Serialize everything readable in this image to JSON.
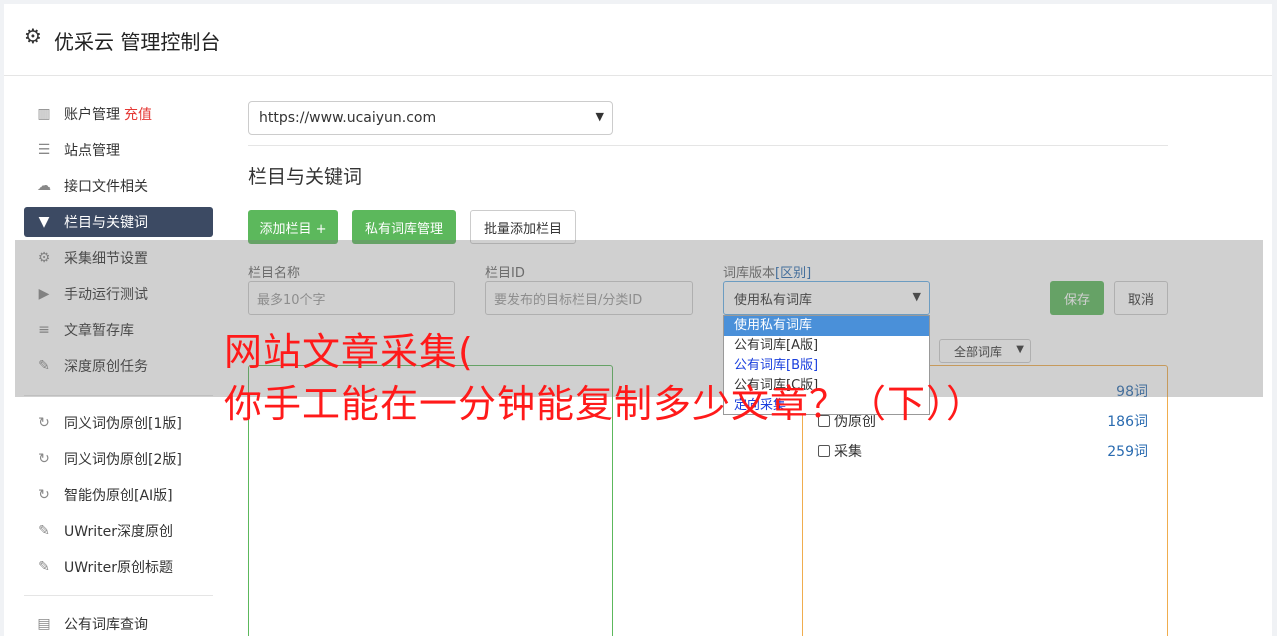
{
  "header": {
    "title": "优采云 管理控制台",
    "icon": "gear-icon"
  },
  "sidebar": {
    "items": [
      {
        "label": "账户管理",
        "badge": "充值",
        "icon": "bar-chart-icon"
      },
      {
        "label": "站点管理",
        "icon": "server-icon"
      },
      {
        "label": "接口文件相关",
        "icon": "cloud-upload-icon"
      },
      {
        "label": "栏目与关键词",
        "icon": "filter-icon",
        "active": true
      },
      {
        "label": "采集细节设置",
        "icon": "gears-icon"
      },
      {
        "label": "手动运行测试",
        "icon": "play-circle-icon"
      },
      {
        "label": "文章暂存库",
        "icon": "database-icon"
      },
      {
        "label": "深度原创任务",
        "icon": "edit-icon"
      },
      {
        "label": "同义词伪原创[1版]",
        "icon": "refresh-icon"
      },
      {
        "label": "同义词伪原创[2版]",
        "icon": "refresh-icon"
      },
      {
        "label": "智能伪原创[AI版]",
        "icon": "refresh-icon"
      },
      {
        "label": "UWriter深度原创",
        "icon": "edit-icon"
      },
      {
        "label": "UWriter原创标题",
        "icon": "edit-icon"
      },
      {
        "label": "公有词库查询",
        "icon": "book-icon"
      }
    ]
  },
  "site_select": {
    "value": "https://www.ucaiyun.com"
  },
  "section": {
    "title": "栏目与关键词"
  },
  "toolbar": {
    "add_column": "添加栏目 +",
    "private_lib": "私有词库管理",
    "batch_add": "批量添加栏目"
  },
  "form": {
    "name_label": "栏目名称",
    "name_placeholder": "最多10个字",
    "id_label": "栏目ID",
    "id_placeholder": "要发布的目标栏目/分类ID",
    "lib_label": "词库版本",
    "lib_label_link": "[区别]",
    "lib_value": "使用私有词库",
    "save": "保存",
    "cancel": "取消"
  },
  "dropdown": {
    "options": [
      "使用私有词库",
      "公有词库[A版]",
      "公有词库[B版]",
      "公有词库[C版]",
      "定向采集"
    ]
  },
  "filter": {
    "value": "全部词库"
  },
  "libraries": [
    {
      "label": "",
      "count": "98词"
    },
    {
      "label": "伪原创",
      "count": "186词"
    },
    {
      "label": "采集",
      "count": "259词"
    }
  ],
  "watermark": {
    "line1": "网站文章采集(",
    "line2": "你手工能在一分钟能复制多少文章？（下））"
  },
  "colors": {
    "accent_green": "#5cb85c",
    "sidebar_active": "#3c4a63",
    "watermark": "#ff1a1a"
  }
}
